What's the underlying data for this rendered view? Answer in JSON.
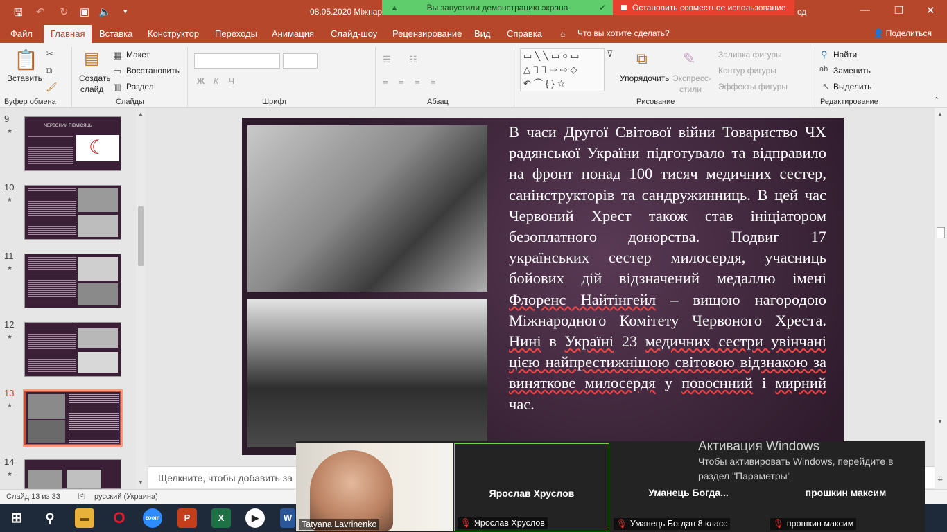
{
  "titlebar": {
    "title": "08.05.2020 Міжнаро",
    "title_tail": "од",
    "share_active": "Вы запустили демонстрацию экрана",
    "share_stop": "Остановить совместное использование"
  },
  "tabs": [
    "Файл",
    "Главная",
    "Вставка",
    "Конструктор",
    "Переходы",
    "Анимация",
    "Слайд-шоу",
    "Рецензирование",
    "Вид",
    "Справка"
  ],
  "active_tab": "Главная",
  "tell_me": "Что вы хотите сделать?",
  "share_button": "Поделиться",
  "ribbon": {
    "paste": "Вставить",
    "clipboard_group": "Буфер обмена",
    "new_slide_1": "Создать",
    "new_slide_2": "слайд",
    "layout": "Макет",
    "reset": "Восстановить",
    "section": "Раздел",
    "slides_group": "Слайды",
    "font_group": "Шрифт",
    "paragraph_group": "Абзац",
    "arrange": "Упорядочить",
    "quick_styles_1": "Экспресс-",
    "quick_styles_2": "стили",
    "shape_fill": "Заливка фигуры",
    "shape_outline": "Контур фигуры",
    "shape_effects": "Эффекты фигуры",
    "drawing_group": "Рисование",
    "find": "Найти",
    "replace": "Заменить",
    "select": "Выделить",
    "editing_group": "Редактирование",
    "bold": "Ж",
    "italic": "К",
    "underline": "Ч"
  },
  "thumbnails": [
    {
      "num": "9",
      "title": "ЧЕРВОНИЙ ПІВМІСЯЦЬ"
    },
    {
      "num": "10"
    },
    {
      "num": "11"
    },
    {
      "num": "12"
    },
    {
      "num": "13"
    },
    {
      "num": "14"
    }
  ],
  "slide": {
    "p1": " В часи Другої Світової війни Товариство ЧХ радянської України підготувало та відправило на фронт понад 100 тисяч медичних сестер, санінструкторів та сандружинниць. В цей час Червоний Хрест також став ініціатором безоплатного донорства. Подвиг 17 українських сестер милосердя, учасниць бойових дій відзначений медаллю імені ",
    "u1": "Флоренс Найтінгейл",
    "p2": " – вищою нагородою Міжнародного Комітету Червоного Хреста. ",
    "u2": "Нині",
    "p3": " в ",
    "u3": "Україні",
    "p4": " 23 ",
    "u4": "медичних сестри увінчані цією найпрестижнішою світовою відзнакою за виняткове милосердя",
    "p5": " у ",
    "u5": "повоєнний",
    "p6": " і ",
    "u6": "мирний",
    "p7": " час."
  },
  "notes_placeholder": "Щелкните, чтобы добавить за",
  "status": {
    "slide_of": "Слайд 13 из 33",
    "language": "русский (Украина)"
  },
  "video": {
    "self_name": "Tatyana Lavrinenko",
    "tiles": [
      {
        "display": "Ярослав Хруслов",
        "label": "Ярослав Хруслов"
      },
      {
        "display": "Уманець  Богда...",
        "label": "Уманець Богдан 8 класс"
      },
      {
        "display": "прошкин максим",
        "label": "прошкин максим"
      }
    ]
  },
  "activation": {
    "heading": "Активация Windows",
    "line1": "Чтобы активировать Windows, перейдите в",
    "line2": "раздел \"Параметры\"."
  },
  "taskbar_apps": [
    "search-icon",
    "file-explorer-icon",
    "opera-icon",
    "zoom-icon",
    "powerpoint-icon",
    "excel-icon",
    "media-player-icon",
    "word-icon"
  ],
  "colors": {
    "accent": "#b7472a",
    "share_green": "#5fcd6b",
    "share_red": "#e8412f",
    "slide_bg": "#3a2236"
  }
}
